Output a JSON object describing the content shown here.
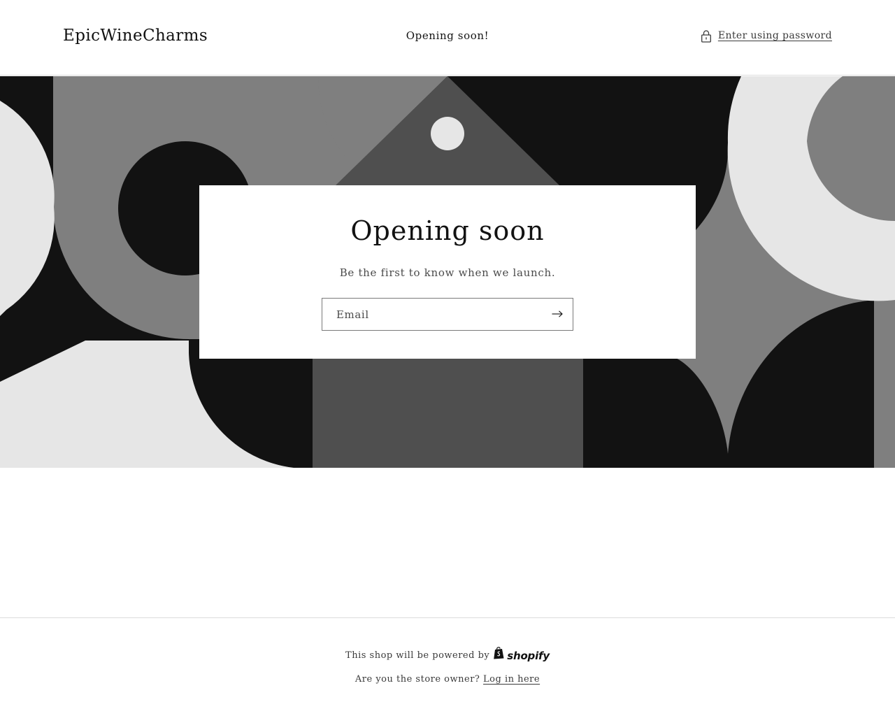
{
  "header": {
    "logo": "EpicWineCharms",
    "announcement": "Opening soon!",
    "password_link": "Enter using password",
    "password_icon": "lock-icon"
  },
  "banner": {
    "colors": {
      "black": "#121212",
      "dark_gray": "#4f4f4f",
      "mid_gray": "#7f7f7f",
      "light_gray": "#e6e6e6"
    }
  },
  "card": {
    "title": "Opening soon",
    "subtitle": "Be the first to know when we launch.",
    "email_placeholder": "Email",
    "email_value": "",
    "submit_icon": "arrow-right-icon"
  },
  "footer": {
    "powered_text": "This shop will be powered by",
    "brand": "shopify",
    "brand_icon": "shopify-bag-icon",
    "owner_text": "Are you the store owner?",
    "login_link": "Log in here"
  }
}
